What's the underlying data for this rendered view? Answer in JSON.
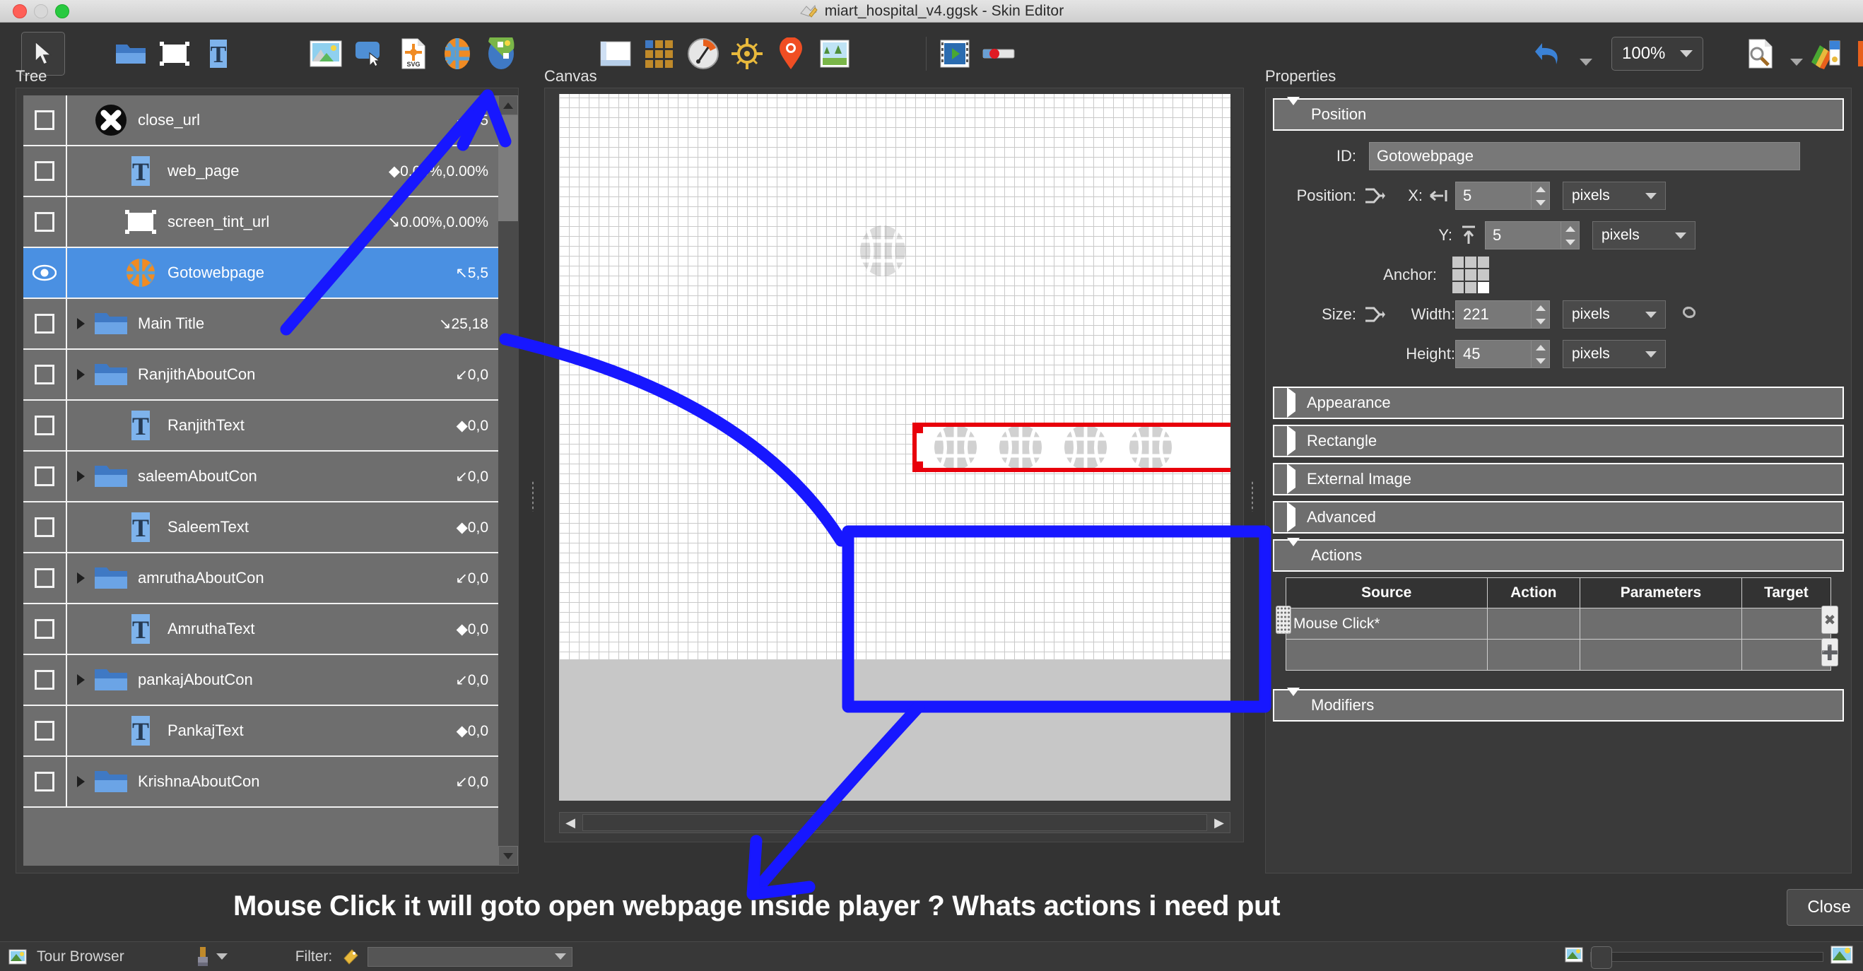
{
  "window": {
    "title": "miart_hospital_v4.ggsk - Skin Editor",
    "app_icon": "skin-editor-icon"
  },
  "toolbar": {
    "left_tools": [
      {
        "name": "select-tool-icon",
        "label": "Select"
      },
      {
        "name": "folder-tool-icon",
        "label": "Container"
      },
      {
        "name": "rectangle-tool-icon",
        "label": "Rectangle"
      },
      {
        "name": "text-tool-icon",
        "label": "Text"
      }
    ],
    "media_tools": [
      {
        "name": "image-tool-icon",
        "label": "Image"
      },
      {
        "name": "button-tool-icon",
        "label": "Button"
      },
      {
        "name": "svg-tool-icon",
        "label": "SVG"
      },
      {
        "name": "webframe-tool-icon",
        "label": "Web Frame"
      },
      {
        "name": "map-tool-icon",
        "label": "Map"
      }
    ],
    "view_tools": [
      {
        "name": "viewer-tool-icon",
        "label": "Viewer"
      },
      {
        "name": "thumbnail-grid-tool-icon",
        "label": "Thumbnails"
      },
      {
        "name": "compass-tool-icon",
        "label": "Compass"
      },
      {
        "name": "radar-tool-icon",
        "label": "Radar"
      },
      {
        "name": "hotspot-tool-icon",
        "label": "Hotspot"
      },
      {
        "name": "map-image-tool-icon",
        "label": "Map Image"
      }
    ],
    "player_tools": [
      {
        "name": "video-tool-icon",
        "label": "Video"
      },
      {
        "name": "progressbar-tool-icon",
        "label": "Progress Bar"
      }
    ],
    "undo_label": "undo-icon",
    "zoom_value": "100%",
    "right_tools": [
      {
        "name": "preview-tool-icon",
        "label": "Preview"
      },
      {
        "name": "palette-tool-icon",
        "label": "Palette"
      },
      {
        "name": "color-tool-icon",
        "label": "Colors"
      }
    ]
  },
  "panels": {
    "tree_label": "Tree",
    "canvas_label": "Canvas",
    "properties_label": "Properties"
  },
  "tree": {
    "items": [
      {
        "name": "close_url",
        "coord": "5,5",
        "glyph": "↙",
        "icon": "close-circle-icon",
        "indent": 0,
        "expandable": false,
        "selected": false,
        "visible": false
      },
      {
        "name": "web_page",
        "coord": "0.00%,0.00%",
        "glyph": "◆",
        "icon": "text-item-icon",
        "indent": 1,
        "expandable": false,
        "selected": false,
        "visible": false
      },
      {
        "name": "screen_tint_url",
        "coord": "0.00%,0.00%",
        "glyph": "↘",
        "icon": "rect-item-icon",
        "indent": 1,
        "expandable": false,
        "selected": false,
        "visible": false
      },
      {
        "name": "Gotowebpage",
        "coord": "5,5",
        "glyph": "↖",
        "icon": "globe-item-icon",
        "indent": 1,
        "expandable": false,
        "selected": true,
        "visible": true
      },
      {
        "name": "Main Title",
        "coord": "25,18",
        "glyph": "↘",
        "icon": "folder-item-icon",
        "indent": 0,
        "expandable": true,
        "selected": false,
        "visible": false
      },
      {
        "name": "RanjithAboutCon",
        "coord": "0,0",
        "glyph": "↙",
        "icon": "folder-item-icon",
        "indent": 0,
        "expandable": true,
        "selected": false,
        "visible": false
      },
      {
        "name": "RanjithText",
        "coord": "0,0",
        "glyph": "◆",
        "icon": "text-item-icon",
        "indent": 1,
        "expandable": false,
        "selected": false,
        "visible": false
      },
      {
        "name": "saleemAboutCon",
        "coord": "0,0",
        "glyph": "↙",
        "icon": "folder-item-icon",
        "indent": 0,
        "expandable": true,
        "selected": false,
        "visible": false
      },
      {
        "name": "SaleemText",
        "coord": "0,0",
        "glyph": "◆",
        "icon": "text-item-icon",
        "indent": 1,
        "expandable": false,
        "selected": false,
        "visible": false
      },
      {
        "name": "amruthaAboutCon",
        "coord": "0,0",
        "glyph": "↙",
        "icon": "folder-item-icon",
        "indent": 0,
        "expandable": true,
        "selected": false,
        "visible": false
      },
      {
        "name": "AmruthaText",
        "coord": "0,0",
        "glyph": "◆",
        "icon": "text-item-icon",
        "indent": 1,
        "expandable": false,
        "selected": false,
        "visible": false
      },
      {
        "name": "pankajAboutCon",
        "coord": "0,0",
        "glyph": "↙",
        "icon": "folder-item-icon",
        "indent": 0,
        "expandable": true,
        "selected": false,
        "visible": false
      },
      {
        "name": "PankajText",
        "coord": "0,0",
        "glyph": "◆",
        "icon": "text-item-icon",
        "indent": 1,
        "expandable": false,
        "selected": false,
        "visible": false
      },
      {
        "name": "KrishnaAboutCon",
        "coord": "0,0",
        "glyph": "↙",
        "icon": "folder-item-icon",
        "indent": 0,
        "expandable": true,
        "selected": false,
        "visible": false
      }
    ]
  },
  "properties": {
    "position_section": {
      "title": "Position",
      "expanded": true,
      "id_label": "ID:",
      "id_value": "Gotowebpage",
      "position_label": "Position:",
      "x_label": "X:",
      "x_value": "5",
      "x_unit": "pixels",
      "y_label": "Y:",
      "y_value": "5",
      "y_unit": "pixels",
      "anchor_label": "Anchor:",
      "anchor_selected": "bottom-right",
      "size_label": "Size:",
      "width_label": "Width:",
      "width_value": "221",
      "width_unit": "pixels",
      "height_label": "Height:",
      "height_value": "45",
      "height_unit": "pixels"
    },
    "sections": [
      {
        "title": "Appearance",
        "expanded": false
      },
      {
        "title": "Rectangle",
        "expanded": false
      },
      {
        "title": "External Image",
        "expanded": false
      },
      {
        "title": "Advanced",
        "expanded": false
      },
      {
        "title": "Actions",
        "expanded": true
      }
    ],
    "actions": {
      "columns": [
        "Source",
        "Action",
        "Parameters",
        "Target"
      ],
      "rows": [
        {
          "source": "Mouse Click*",
          "action": "",
          "parameters": "",
          "target": ""
        },
        {
          "source": "",
          "action": "",
          "parameters": "",
          "target": ""
        }
      ]
    },
    "modifiers_section": {
      "title": "Modifiers",
      "expanded": true
    }
  },
  "annotation": {
    "text": "Mouse Click it will goto  open webpage inside player ? Whats actions i need put",
    "color": "#1717ff"
  },
  "dialog": {
    "close_label": "Close"
  },
  "statusbar": {
    "tour_browser_label": "Tour Browser",
    "filter_label": "Filter:",
    "filter_value": ""
  },
  "colors": {
    "accent_blue": "#4a90e2",
    "annotation_blue": "#1717ff",
    "selection_red": "#e8000b",
    "panel_bg": "#333333",
    "row_bg": "#6e6e6e"
  }
}
